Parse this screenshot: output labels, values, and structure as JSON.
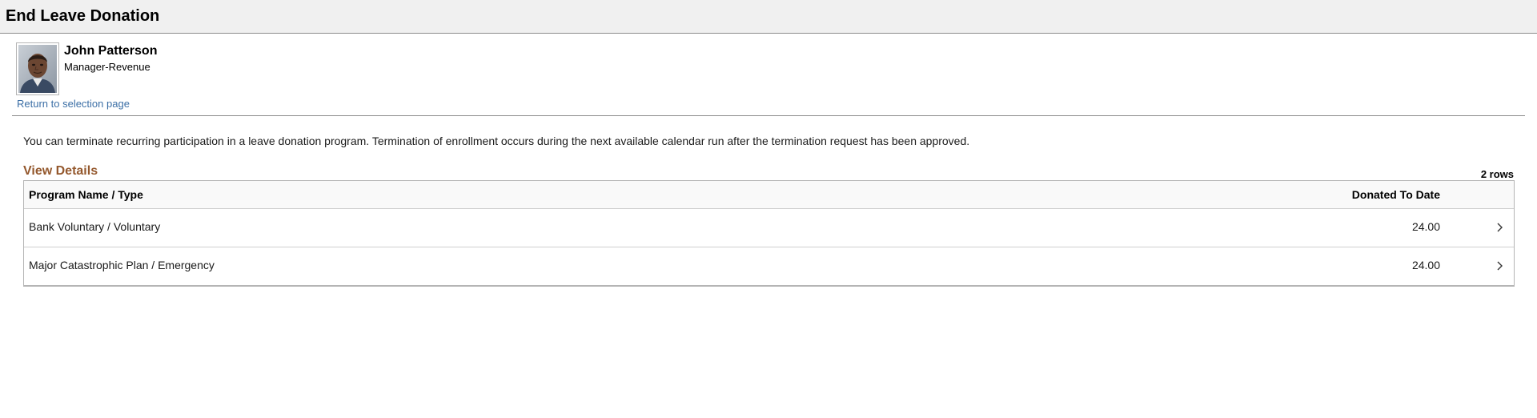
{
  "page": {
    "title": "End Leave Donation"
  },
  "employee": {
    "name": "John Patterson",
    "job_title": "Manager-Revenue",
    "avatar_icon": "employee-photo"
  },
  "links": {
    "return": "Return to selection page"
  },
  "instructions": "You can terminate recurring participation in a leave donation program. Termination of enrollment occurs during the next available calendar run after the termination request has been approved.",
  "grid": {
    "title": "View Details",
    "row_count": "2 rows",
    "columns": {
      "name": "Program Name / Type",
      "donated": "Donated To Date"
    },
    "rows": [
      {
        "name": "Bank Voluntary / Voluntary",
        "donated": "24.00",
        "icon": "chevron-right-icon"
      },
      {
        "name": "Major Catastrophic Plan / Emergency",
        "donated": "24.00",
        "icon": "chevron-right-icon"
      }
    ]
  },
  "colors": {
    "title_bar_bg": "#f0f0f0",
    "link": "#3c6fa6",
    "grid_title": "#94582d"
  }
}
